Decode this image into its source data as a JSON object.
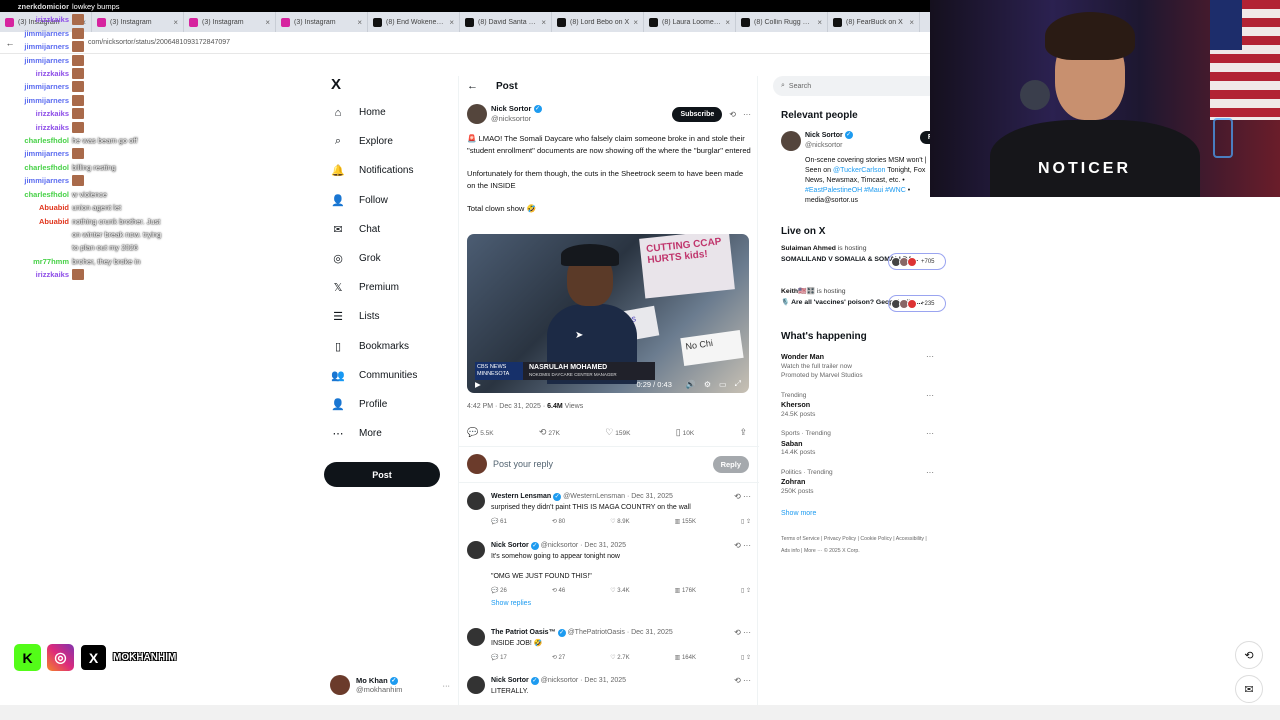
{
  "browser": {
    "tabs": [
      {
        "label": "(3) Instagram",
        "icon": "instagram-icon"
      },
      {
        "label": "(3) Instagram",
        "icon": "instagram-icon"
      },
      {
        "label": "(3) Instagram",
        "icon": "instagram-icon"
      },
      {
        "label": "(3) Instagram",
        "icon": "instagram-icon"
      },
      {
        "label": "(8) End Wokeness on",
        "icon": "x-icon"
      },
      {
        "label": "(8) David Santa Carla",
        "icon": "x-icon"
      },
      {
        "label": "(8) Lord Bebo on X",
        "icon": "x-icon"
      },
      {
        "label": "(8) Laura Loomer on",
        "icon": "x-icon"
      },
      {
        "label": "(8) Collin Rugg on X",
        "icon": "x-icon"
      },
      {
        "label": "(8) FearBuck on X",
        "icon": "x-icon"
      }
    ],
    "url": "com/nicksortor/status/2006481093172847097"
  },
  "chat": [
    {
      "user": "znerkdomicior",
      "msg": "lowkey bumps",
      "color": "white"
    },
    {
      "user": "irizzkaiks",
      "msg": "",
      "color": "purple"
    },
    {
      "user": "jimmijarners",
      "msg": "",
      "color": "blue"
    },
    {
      "user": "jimmijarners",
      "msg": "",
      "color": "blue"
    },
    {
      "user": "jimmijarners",
      "msg": "",
      "color": "blue"
    },
    {
      "user": "irizzkaiks",
      "msg": "",
      "color": "purple"
    },
    {
      "user": "jimmijarners",
      "msg": "",
      "color": "blue"
    },
    {
      "user": "jimmijarners",
      "msg": "",
      "color": "blue"
    },
    {
      "user": "irizzkaiks",
      "msg": "",
      "color": "purple"
    },
    {
      "user": "irizzkaiks",
      "msg": "",
      "color": "purple"
    },
    {
      "user": "charlesfhdol",
      "msg": "he was beam go off",
      "color": "green"
    },
    {
      "user": "jimmijarners",
      "msg": "",
      "color": "blue"
    },
    {
      "user": "charlesfhdol",
      "msg": "billing resting",
      "color": "green"
    },
    {
      "user": "jimmijarners",
      "msg": "",
      "color": "blue"
    },
    {
      "user": "charlesfhdol",
      "msg": "w violence",
      "color": "green"
    },
    {
      "user": "Abuabid",
      "msg": "union agent let",
      "color": "red"
    },
    {
      "user": "Abuabid",
      "msg": "nothing crunk brother. Just",
      "color": "red"
    },
    {
      "user": "",
      "msg": "on winter break now. trying",
      "color": "red"
    },
    {
      "user": "",
      "msg": "to plan out my 2026",
      "color": "red"
    },
    {
      "user": "mr77hmm",
      "msg": "broher, they broke in",
      "color": "green"
    },
    {
      "user": "irizzkaiks",
      "msg": "",
      "color": "purple"
    }
  ],
  "nav": {
    "logo": "X",
    "items": [
      {
        "label": "Home",
        "icon": "home-icon",
        "glyph": "⌂"
      },
      {
        "label": "Explore",
        "icon": "search-icon",
        "glyph": "⌕"
      },
      {
        "label": "Notifications",
        "icon": "bell-icon",
        "glyph": "🔔"
      },
      {
        "label": "Follow",
        "icon": "follow-icon",
        "glyph": "👤"
      },
      {
        "label": "Chat",
        "icon": "mail-icon",
        "glyph": "✉"
      },
      {
        "label": "Grok",
        "icon": "grok-icon",
        "glyph": "◎"
      },
      {
        "label": "Premium",
        "icon": "x-premium-icon",
        "glyph": "𝕏"
      },
      {
        "label": "Lists",
        "icon": "list-icon",
        "glyph": "☰"
      },
      {
        "label": "Bookmarks",
        "icon": "bookmark-icon",
        "glyph": "▯"
      },
      {
        "label": "Communities",
        "icon": "communities-icon",
        "glyph": "👥"
      },
      {
        "label": "Profile",
        "icon": "profile-icon",
        "glyph": "👤"
      },
      {
        "label": "More",
        "icon": "more-icon",
        "glyph": "⋯"
      }
    ],
    "post_label": "Post",
    "account": {
      "name": "Mo Khan",
      "handle": "@mokhanhim"
    }
  },
  "post": {
    "header": "Post",
    "author": "Nick Sortor",
    "handle": "@nicksortor",
    "subscribe": "Subscribe",
    "text1": "🚨 LMAO! The Somali Daycare who falsely claim someone broke in and stole their \"student enrollment\" documents are now showing off the where the \"burglar\" entered",
    "text2": "Unfortunately for them though, the cuts in the Sheetrock seem to have been made on the INSIDE",
    "text3": "Total clown show 🤣",
    "video": {
      "chyron_tag": "CBS NEWS MINNESOTA",
      "chyron_name": "NASRULAH MOHAMED",
      "chyron_title": "NOKOMIS DAYCARE CENTER MANAGER",
      "time": "0:29 / 0:43",
      "sign1": "CUTTING CCAP HURTS kids!",
      "sign2": "No Chi",
      "sign3": "Has"
    },
    "time": "4:42 PM · Dec 31, 2025 · ",
    "views": "6.4M",
    "views_label": " Views",
    "stats": {
      "replies": "5.5K",
      "reposts": "27K",
      "likes": "159K",
      "bookmarks": "10K"
    },
    "reply_placeholder": "Post your reply",
    "reply_button": "Reply"
  },
  "replies": [
    {
      "name": "Western Lensman",
      "handle": "@WesternLensman · Dec 31, 2025",
      "text": "surprised they didn't paint THIS IS MAGA COUNTRY on the wall",
      "replies": "61",
      "reposts": "80",
      "likes": "8.9K",
      "views": "155K",
      "show": ""
    },
    {
      "name": "Nick Sortor",
      "handle": "@nicksortor · Dec 31, 2025",
      "text": "It's somehow going to appear tonight now",
      "text2": "\"OMG WE JUST FOUND THIS!\"",
      "replies": "26",
      "reposts": "46",
      "likes": "3.4K",
      "views": "176K",
      "show": "Show replies"
    },
    {
      "name": "The Patriot Oasis™",
      "handle": "@ThePatriotOasis · Dec 31, 2025",
      "text": "INSIDE JOB! 🤣",
      "replies": "17",
      "reposts": "27",
      "likes": "2.7K",
      "views": "164K",
      "show": ""
    },
    {
      "name": "Nick Sortor",
      "handle": "@nicksortor · Dec 31, 2025",
      "text": "LITERALLY.",
      "replies": "",
      "reposts": "",
      "likes": "",
      "views": "",
      "show": ""
    }
  ],
  "right": {
    "search_placeholder": "Search",
    "relevant_title": "Relevant people",
    "relevant": {
      "name": "Nick Sortor",
      "handle": "@nicksortor",
      "follow": "Follow",
      "bio": "On-scene covering stories MSM won't | Seen on ",
      "bio_link1": "@TuckerCarlson",
      "bio2": " Tonight, Fox News, Newsmax, Timcast, etc. • ",
      "bio_link2": "#EastPalestineOH #Maui #WNC",
      "bio3": " • media@sortor.us"
    },
    "live_title": "Live on X",
    "live": [
      {
        "host": "Sulaiman Ahmed",
        "suffix": " is hosting",
        "title": "SOMALILAND V SOMALIA & SOMALI DA...",
        "count": "+705"
      },
      {
        "host": "Keith🇺🇸🎛️",
        "suffix": " is hosting",
        "title": "🎙️ Are all 'vaccines' poison? Geopol-Bibi-...",
        "count": "+235"
      }
    ],
    "happening_title": "What's happening",
    "trends": [
      {
        "context": "",
        "title": "Wonder Man",
        "sub": "Watch the full trailer now",
        "promo": "Promoted by Marvel Studios"
      },
      {
        "context": "Trending",
        "title": "Kherson",
        "sub": "24.5K posts",
        "promo": ""
      },
      {
        "context": "Sports · Trending",
        "title": "Saban",
        "sub": "14.4K posts",
        "promo": ""
      },
      {
        "context": "Politics · Trending",
        "title": "Zohran",
        "sub": "250K posts",
        "promo": ""
      }
    ],
    "show_more": "Show more",
    "footer": "Terms of Service | Privacy Policy | Cookie Policy | Accessibility | Ads info | More ··· © 2025 X Corp."
  },
  "overlay": {
    "webcam_text": "NOTICER",
    "social_handle": "MOKHANHIM"
  }
}
